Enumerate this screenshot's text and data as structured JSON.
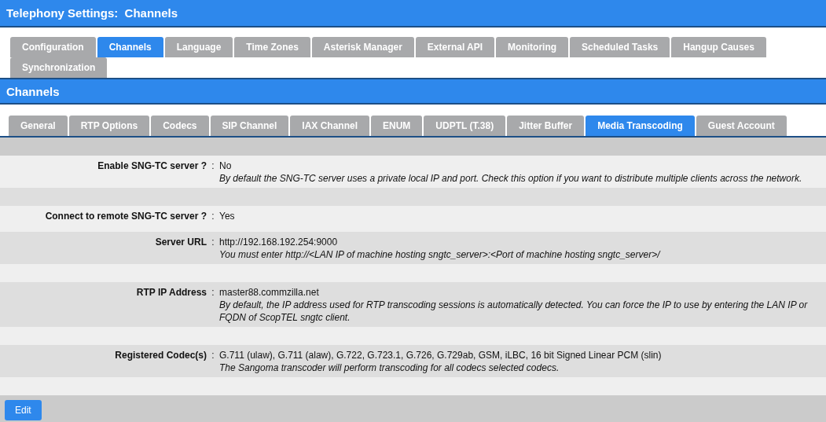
{
  "page_title": "Telephony Settings:  Channels",
  "main_tabs": [
    {
      "label": "Configuration",
      "selected": false
    },
    {
      "label": "Channels",
      "selected": true
    },
    {
      "label": "Language",
      "selected": false
    },
    {
      "label": "Time Zones",
      "selected": false
    },
    {
      "label": "Asterisk Manager",
      "selected": false
    },
    {
      "label": "External API",
      "selected": false
    },
    {
      "label": "Monitoring",
      "selected": false
    },
    {
      "label": "Scheduled Tasks",
      "selected": false
    },
    {
      "label": "Hangup Causes",
      "selected": false
    },
    {
      "label": "Synchronization",
      "selected": false
    }
  ],
  "section_title": "Channels",
  "sub_tabs": [
    {
      "label": "General",
      "selected": false
    },
    {
      "label": "RTP Options",
      "selected": false
    },
    {
      "label": "Codecs",
      "selected": false
    },
    {
      "label": "SIP Channel",
      "selected": false
    },
    {
      "label": "IAX Channel",
      "selected": false
    },
    {
      "label": "ENUM",
      "selected": false
    },
    {
      "label": "UDPTL (T.38)",
      "selected": false
    },
    {
      "label": "Jitter Buffer",
      "selected": false
    },
    {
      "label": "Media Transcoding",
      "selected": true
    },
    {
      "label": "Guest Account",
      "selected": false
    }
  ],
  "rows": [
    {
      "kind": "field",
      "label": "Enable SNG-TC server ?",
      "separator": ":",
      "value": "No",
      "hint": "By default the SNG-TC server uses a private local IP and port. Check this option if you want to distribute multiple clients across the network."
    },
    {
      "kind": "spacer"
    },
    {
      "kind": "field",
      "label": "Connect to remote SNG-TC server ?",
      "separator": ":",
      "value": "Yes"
    },
    {
      "kind": "field",
      "label": "Server URL",
      "separator": ":",
      "value": "http://192.168.192.254:9000",
      "hint": "You must enter http://<LAN IP of machine hosting sngtc_server>:<Port of machine hosting sngtc_server>/"
    },
    {
      "kind": "spacer"
    },
    {
      "kind": "field",
      "label": "RTP IP Address",
      "separator": ":",
      "value": "master88.commzilla.net",
      "hint": "By default, the IP address used for RTP transcoding sessions is automatically detected. You can force the IP to use by entering the LAN IP or FQDN of ScopTEL sngtc client."
    },
    {
      "kind": "spacer"
    },
    {
      "kind": "field",
      "label": "Registered Codec(s)",
      "separator": ":",
      "value": "G.711 (ulaw), G.711 (alaw), G.722, G.723.1, G.726, G.729ab, GSM, iLBC, 16 bit Signed Linear PCM (slin)",
      "hint": "The Sangoma transcoder will perform transcoding for all codecs selected codecs."
    },
    {
      "kind": "spacer"
    }
  ],
  "edit_button": "Edit"
}
